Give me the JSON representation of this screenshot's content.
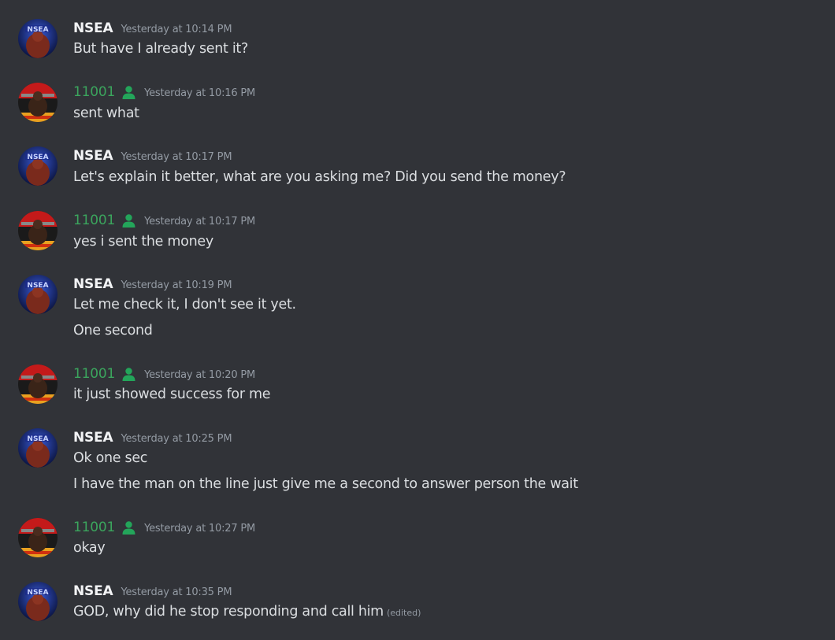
{
  "users": {
    "nsea": {
      "name": "NSEA",
      "color": "#f2f3f5"
    },
    "u11001": {
      "name": "11001",
      "color": "#3ba55d",
      "badge_icon": "member-person-icon",
      "badge_color": "#23a55a"
    }
  },
  "edited_label": "(edited)",
  "messages": [
    {
      "user": "NSEA",
      "timestamp": "Yesterday at 10:14 PM",
      "lines": [
        "But have I already sent it?"
      ]
    },
    {
      "user": "11001",
      "timestamp": "Yesterday at 10:16 PM",
      "lines": [
        "sent what"
      ]
    },
    {
      "user": "NSEA",
      "timestamp": "Yesterday at 10:17 PM",
      "lines": [
        "Let's explain it better, what are you asking me? Did you send the money?"
      ]
    },
    {
      "user": "11001",
      "timestamp": "Yesterday at 10:17 PM",
      "lines": [
        "yes i sent the money"
      ]
    },
    {
      "user": "NSEA",
      "timestamp": "Yesterday at 10:19 PM",
      "lines": [
        "Let me check it, I don't see it yet.",
        "One second"
      ]
    },
    {
      "user": "11001",
      "timestamp": "Yesterday at 10:20 PM",
      "lines": [
        "it just showed success for me"
      ]
    },
    {
      "user": "NSEA",
      "timestamp": "Yesterday at 10:25 PM",
      "lines": [
        "Ok one sec",
        "I have the man on the line just give me a second to answer person the wait"
      ]
    },
    {
      "user": "11001",
      "timestamp": "Yesterday at 10:27 PM",
      "lines": [
        "okay"
      ]
    },
    {
      "user": "NSEA",
      "timestamp": "Yesterday at 10:35 PM",
      "lines": [
        "GOD, why did he stop responding and call him"
      ],
      "edited": true
    }
  ]
}
